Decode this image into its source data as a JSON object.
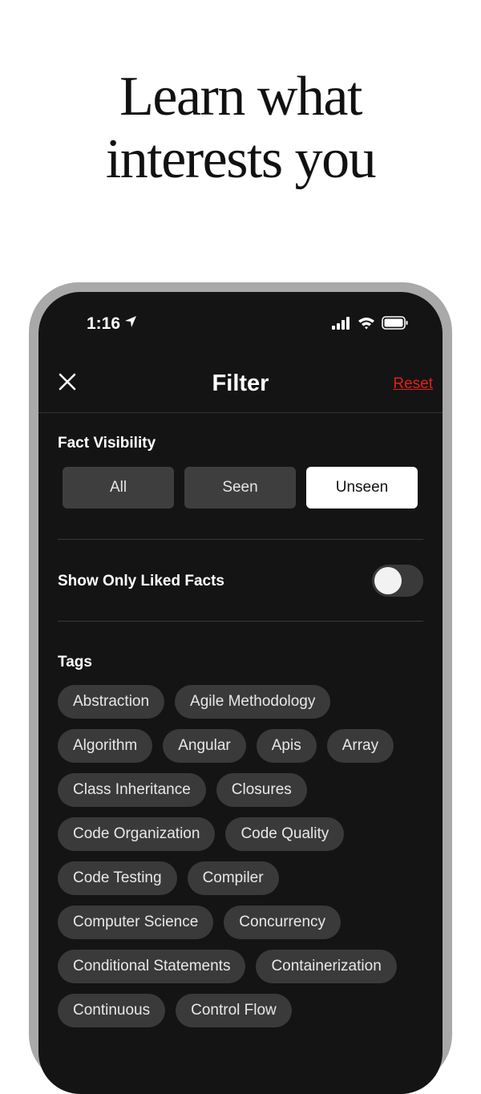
{
  "headline": {
    "line1": "Learn what",
    "line2": "interests you"
  },
  "status_bar": {
    "time": "1:16"
  },
  "nav": {
    "title": "Filter",
    "reset_label": "Reset"
  },
  "fact_visibility": {
    "label": "Fact Visibility",
    "options": [
      "All",
      "Seen",
      "Unseen"
    ],
    "selected": "Unseen"
  },
  "liked": {
    "label": "Show Only Liked Facts",
    "enabled": false
  },
  "tags": {
    "label": "Tags",
    "items": [
      "Abstraction",
      "Agile Methodology",
      "Algorithm",
      "Angular",
      "Apis",
      "Array",
      "Class Inheritance",
      "Closures",
      "Code Organization",
      "Code Quality",
      "Code Testing",
      "Compiler",
      "Computer Science",
      "Concurrency",
      "Conditional Statements",
      "Containerization",
      "Continuous",
      "Control Flow"
    ]
  },
  "colors": {
    "accent": "#e0201a",
    "screen_bg": "#141414",
    "chip_bg": "#3a3a3a"
  }
}
